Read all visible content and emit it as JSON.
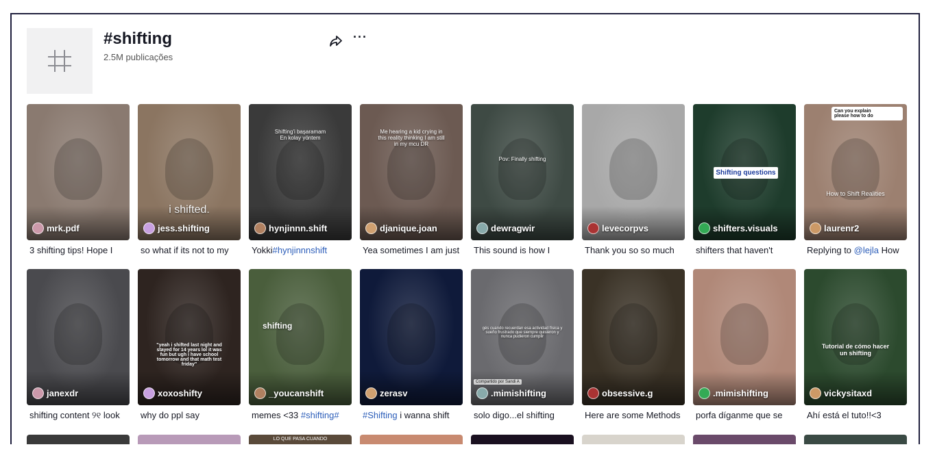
{
  "header": {
    "title": "#shifting",
    "post_count": "2.5M publicações",
    "share_icon": "share-arrow-icon",
    "more_icon": "more-horizontal-icon"
  },
  "videos": [
    {
      "author": "mrk.pdf",
      "caption": "3 shifting tips! Hope I",
      "overlay": "",
      "bg": "#8a7a70"
    },
    {
      "author": "jess.shifting",
      "caption": "so what if its not to my",
      "overlay": "i shifted.",
      "bg": "#8b7561"
    },
    {
      "author": "hynjinnn.shift",
      "caption_pre": "Yokki",
      "caption_tag": "#hynjinnnshift",
      "overlay": "Shifting'i başaramam\nEn kolay yöntem",
      "bg": "#3a3a3a"
    },
    {
      "author": "djanique.joan",
      "caption": "Yea sometimes I am just",
      "overlay": "Me hearing a kid crying in\nthis reality thinking I am still\nin my mcu DR",
      "bg": "#6c5a52"
    },
    {
      "author": "dewragwir",
      "caption": "This sound is how I",
      "overlay": "Pov: Finally shifting",
      "bg": "#3e4a44"
    },
    {
      "author": "levecorpvs",
      "caption": "Thank you so so much",
      "overlay": "",
      "bg": "#a8a8a8"
    },
    {
      "author": "shifters.visuals",
      "caption": "shifters that haven't",
      "overlay": "Shifting questions",
      "bg": "#1e3c2c"
    },
    {
      "author": "laurenr2",
      "caption_pre": "Replying to ",
      "caption_tag": "@lejla",
      "caption_post": " How",
      "overlay": "How to Shift Realities",
      "reply": "Can you explain\nplease how to do",
      "bg": "#9c8070"
    },
    {
      "author": "janexdr",
      "caption": "shifting content ୨୧ look",
      "overlay": "",
      "bg": "#4a4a4e"
    },
    {
      "author": "xoxoshifty",
      "caption": "why do ppl say",
      "overlay": "\"yeah i shifted last night and\nstayed for 14 years lol it was\nfun but ugh i have school\ntomorrow and that math test\nfriday\"",
      "bg": "#2e2420"
    },
    {
      "author": "_youcanshift",
      "caption_pre": "memes <33 ",
      "caption_tag": "#shifting#",
      "overlay": "shifting",
      "bg": "#4a5e3c"
    },
    {
      "author": "zerasv",
      "caption_pre": "",
      "caption_tag": "#Shifting",
      "caption_post": " i wanna shift",
      "overlay": "",
      "bg": "#0f1a3a"
    },
    {
      "author": ".mimishifting",
      "caption": "solo digo...el shifting",
      "overlay": "gés cuando recuerdan esa actividad física y\nsueño frustrado que siempre quisieron y\nnunca pudieron cumplir",
      "share_label": "Compartido por Sandi A",
      "bg": "#6a6a6e"
    },
    {
      "author": "obsessive.g",
      "caption": "Here are some Methods",
      "overlay": "",
      "bg": "#3a3226"
    },
    {
      "author": ".mimishifting",
      "caption": "porfa díganme que se",
      "overlay": "",
      "bg": "#b08878"
    },
    {
      "author": "vickysitaxd",
      "caption": "Ahí está el tuto!!<3",
      "overlay": "Tutorial de cómo hacer\nun shifting",
      "bg": "#2c4a2e"
    }
  ],
  "row3_colors": [
    "#3a3a3a",
    "#b89ab8",
    "#5a4a3a",
    "#c88a70",
    "#1a1020",
    "#d8d4cc",
    "#6a4a6a",
    "#3a4a44"
  ],
  "row3_overlay": "LO QUE PASA CUANDO"
}
